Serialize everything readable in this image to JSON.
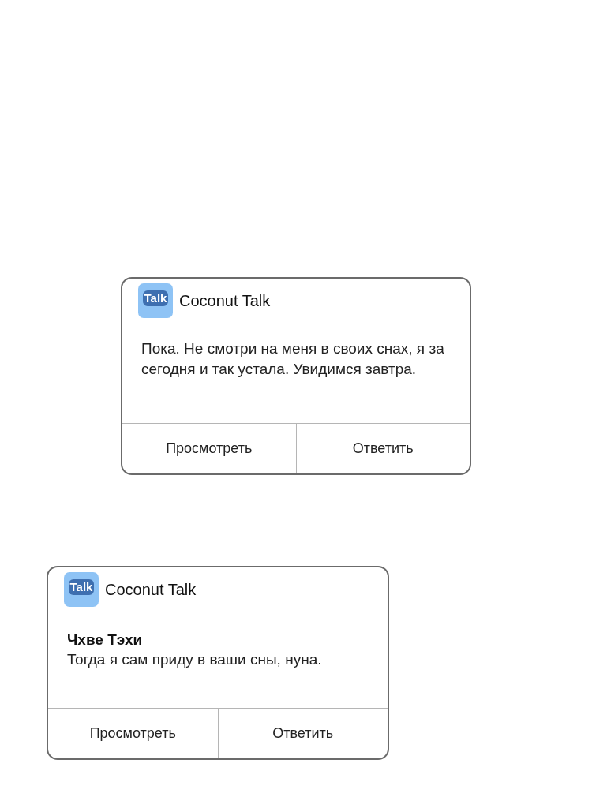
{
  "notifications": [
    {
      "app": {
        "icon_text": "Talk",
        "name": "Coconut Talk"
      },
      "message": "Пока. Не смотри на меня в своих снах, я за сегодня и так устала. Увидимся завтра.",
      "actions": [
        "Просмотреть",
        "Ответить"
      ]
    },
    {
      "app": {
        "icon_text": "Talk",
        "name": "Coconut Talk"
      },
      "sender": "Чхве Тэхи",
      "message": "Тогда я сам приду в ваши сны, нуна.",
      "actions": [
        "Просмотреть",
        "Ответить"
      ]
    }
  ]
}
